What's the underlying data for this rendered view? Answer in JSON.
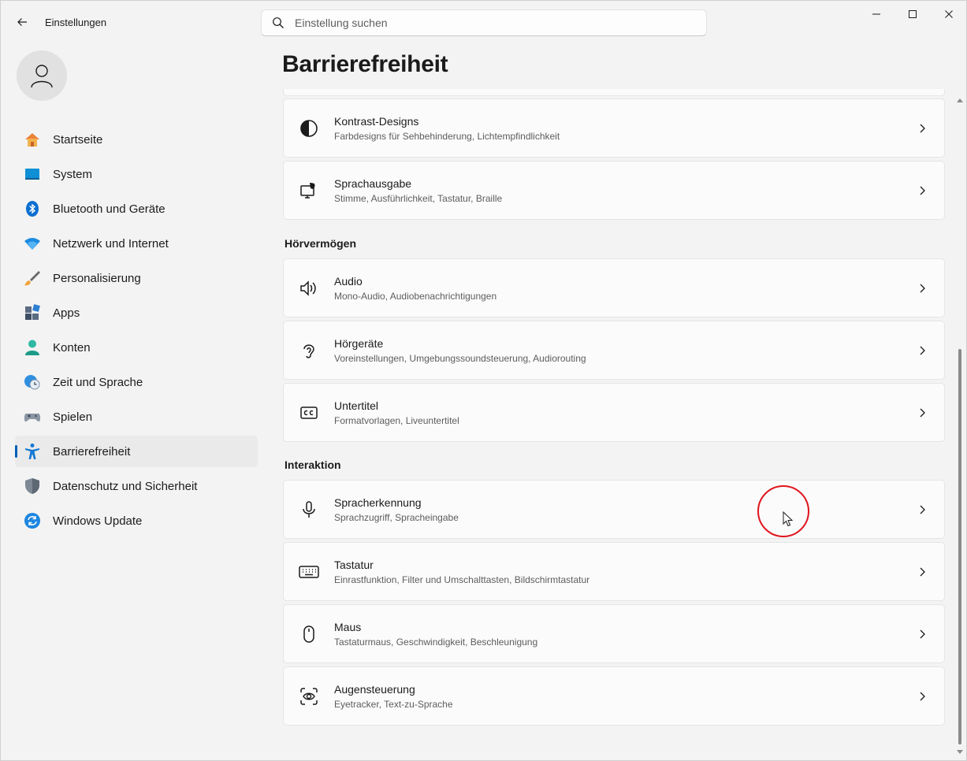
{
  "app": {
    "title": "Einstellungen",
    "search_placeholder": "Einstellung suchen"
  },
  "sidebar": {
    "items": [
      {
        "label": "Startseite",
        "icon": "home-icon"
      },
      {
        "label": "System",
        "icon": "system-icon"
      },
      {
        "label": "Bluetooth und Geräte",
        "icon": "bluetooth-icon"
      },
      {
        "label": "Netzwerk und Internet",
        "icon": "wifi-icon"
      },
      {
        "label": "Personalisierung",
        "icon": "brush-icon"
      },
      {
        "label": "Apps",
        "icon": "apps-icon"
      },
      {
        "label": "Konten",
        "icon": "account-icon"
      },
      {
        "label": "Zeit und Sprache",
        "icon": "time-language-icon"
      },
      {
        "label": "Spielen",
        "icon": "gamepad-icon"
      },
      {
        "label": "Barrierefreiheit",
        "icon": "accessibility-icon",
        "active": true
      },
      {
        "label": "Datenschutz und Sicherheit",
        "icon": "shield-icon"
      },
      {
        "label": "Windows Update",
        "icon": "update-icon"
      }
    ]
  },
  "page": {
    "title": "Barrierefreiheit"
  },
  "cards": {
    "kontrast": {
      "title": "Kontrast-Designs",
      "sub": "Farbdesigns für Sehbehinderung, Lichtempfindlichkeit"
    },
    "sprachausgabe": {
      "title": "Sprachausgabe",
      "sub": "Stimme, Ausführlichkeit, Tastatur, Braille"
    },
    "audio": {
      "title": "Audio",
      "sub": "Mono-Audio, Audiobenachrichtigungen"
    },
    "hoergeraete": {
      "title": "Hörgeräte",
      "sub": "Voreinstellungen, Umgebungssoundsteuerung, Audiorouting"
    },
    "untertitel": {
      "title": "Untertitel",
      "sub": "Formatvorlagen, Liveuntertitel"
    },
    "spracherkennung": {
      "title": "Spracherkennung",
      "sub": "Sprachzugriff, Spracheingabe"
    },
    "tastatur": {
      "title": "Tastatur",
      "sub": "Einrastfunktion, Filter und Umschalttasten, Bildschirmtastatur"
    },
    "maus": {
      "title": "Maus",
      "sub": "Tastaturmaus, Geschwindigkeit, Beschleunigung"
    },
    "augensteuerung": {
      "title": "Augensteuerung",
      "sub": "Eyetracker, Text-zu-Sprache"
    }
  },
  "sections": {
    "hoervermoegen": "Hörvermögen",
    "interaktion": "Interaktion"
  },
  "colors": {
    "accent": "#005fb8",
    "click_indicator": "#e0141e"
  }
}
